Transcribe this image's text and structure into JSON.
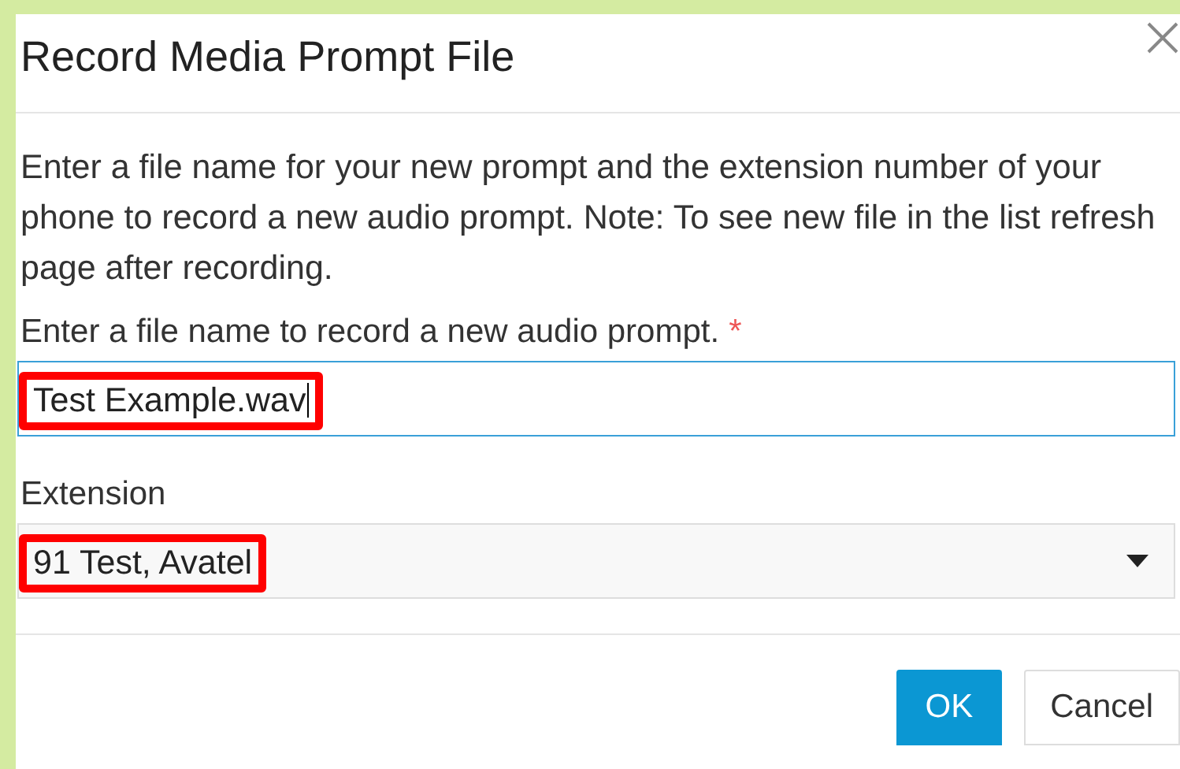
{
  "dialog": {
    "title": "Record Media Prompt File",
    "description": "Enter a file name for your new prompt and the extension number of your phone to record a new audio prompt. Note: To see new file in the list refresh page after recording.",
    "fields": [
      {
        "kind": "text",
        "label": "Enter a file name to record a new audio prompt.",
        "required_mark": "*",
        "value": "Test Example.wav",
        "focused": true,
        "highlighted": true
      },
      {
        "kind": "select",
        "label": "Extension",
        "value": "91 Test, Avatel",
        "focused": false,
        "highlighted": true
      }
    ],
    "buttons": [
      {
        "label": "OK",
        "primary": true
      },
      {
        "label": "Cancel",
        "primary": false
      }
    ]
  }
}
